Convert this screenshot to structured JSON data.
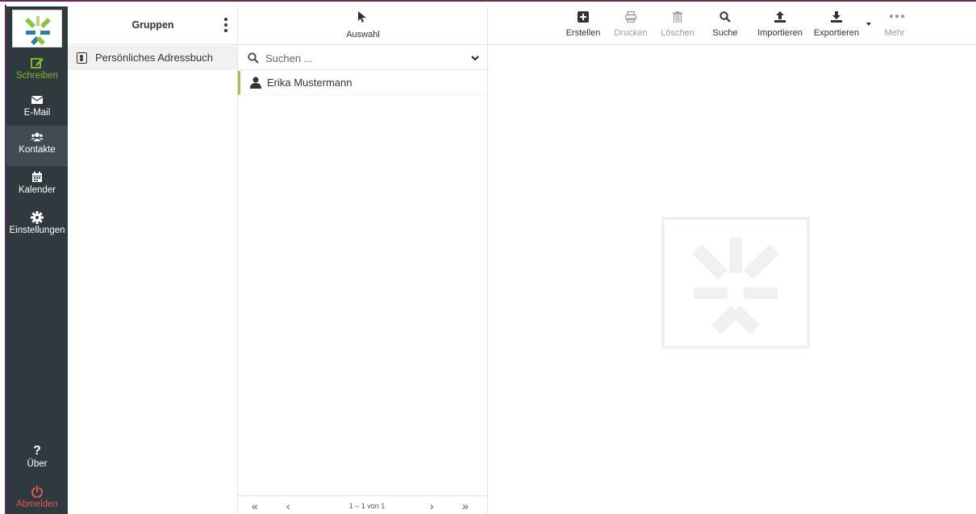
{
  "nav": {
    "items": [
      {
        "key": "compose",
        "label": "Schreiben",
        "icon": "edit-icon"
      },
      {
        "key": "mail",
        "label": "E-Mail",
        "icon": "envelope-icon"
      },
      {
        "key": "contacts",
        "label": "Kontakte",
        "icon": "users-icon"
      },
      {
        "key": "calendar",
        "label": "Kalender",
        "icon": "calendar-icon"
      },
      {
        "key": "settings",
        "label": "Einstellungen",
        "icon": "gear-icon"
      }
    ],
    "bottom": [
      {
        "key": "about",
        "label": "Über",
        "icon": "question-icon"
      },
      {
        "key": "logout",
        "label": "Abmelden",
        "icon": "power-icon"
      }
    ],
    "active": "contacts",
    "colors": {
      "background": "#2f3a3f",
      "active": "#3f4b51",
      "accent": "#7fb52a",
      "logout": "#e25552"
    }
  },
  "groups": {
    "title": "Gruppen",
    "items": [
      {
        "label": "Persönliches Adressbuch"
      }
    ]
  },
  "list": {
    "selection_label": "Auswahl",
    "search": {
      "value": "",
      "placeholder": "Suchen ..."
    },
    "contacts": [
      {
        "name": "Erika Mustermann"
      }
    ],
    "pager": {
      "info": "1 – 1 von 1",
      "first": "«",
      "prev": "‹",
      "next": "›",
      "last": "»"
    }
  },
  "toolbar": {
    "create": "Erstellen",
    "print": "Drucken",
    "delete": "Löschen",
    "search": "Suche",
    "import": "Importieren",
    "export": "Exportieren",
    "more": "Mehr"
  }
}
